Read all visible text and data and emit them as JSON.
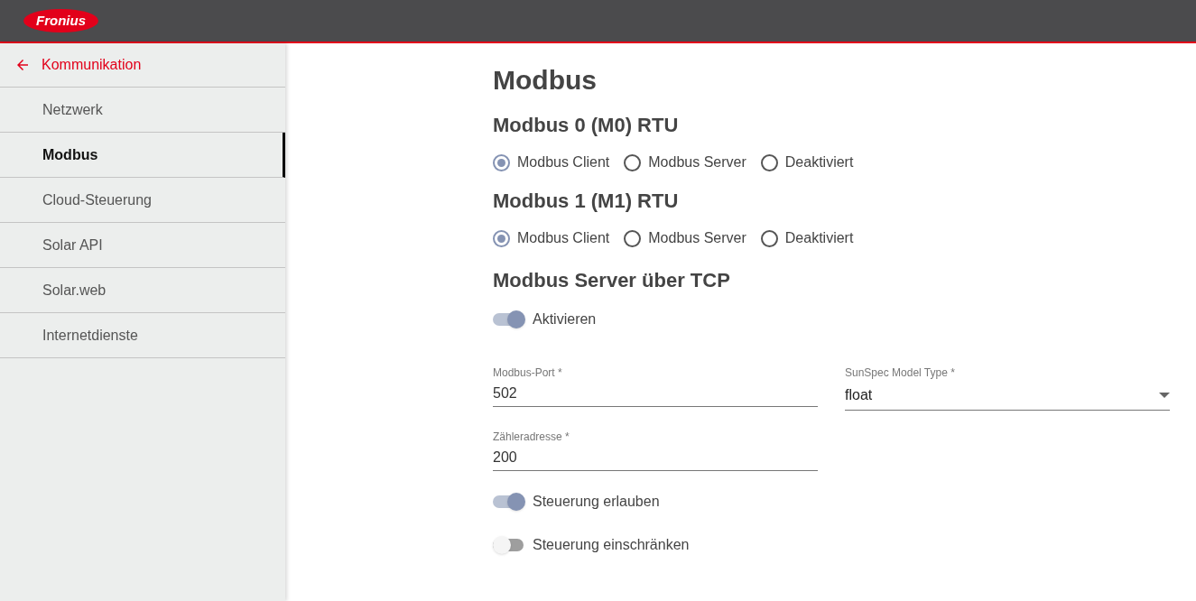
{
  "header": {
    "logo": "Fronius"
  },
  "sidebar": {
    "back": {
      "label": "Kommunikation"
    },
    "items": [
      {
        "label": "Netzwerk",
        "selected": false
      },
      {
        "label": "Modbus",
        "selected": true
      },
      {
        "label": "Cloud-Steuerung",
        "selected": false
      },
      {
        "label": "Solar API",
        "selected": false
      },
      {
        "label": "Solar.web",
        "selected": false
      },
      {
        "label": "Internetdienste",
        "selected": false
      }
    ]
  },
  "page": {
    "title": "Modbus",
    "rtu_sections": [
      {
        "title": "Modbus 0 (M0) RTU",
        "options": [
          {
            "label": "Modbus Client",
            "selected": true
          },
          {
            "label": "Modbus Server",
            "selected": false
          },
          {
            "label": "Deaktiviert",
            "selected": false
          }
        ]
      },
      {
        "title": "Modbus 1 (M1) RTU",
        "options": [
          {
            "label": "Modbus Client",
            "selected": true
          },
          {
            "label": "Modbus Server",
            "selected": false
          },
          {
            "label": "Deaktiviert",
            "selected": false
          }
        ]
      }
    ],
    "tcp": {
      "title": "Modbus Server über TCP",
      "enable": {
        "label": "Aktivieren",
        "on": true
      },
      "port": {
        "label": "Modbus-Port *",
        "value": "502"
      },
      "model_type": {
        "label": "SunSpec Model Type *",
        "value": "float"
      },
      "meter_address": {
        "label": "Zähleradresse *",
        "value": "200"
      },
      "switches": [
        {
          "label": "Steuerung erlauben",
          "on": true
        },
        {
          "label": "Steuerung einschränken",
          "on": false
        }
      ]
    }
  }
}
